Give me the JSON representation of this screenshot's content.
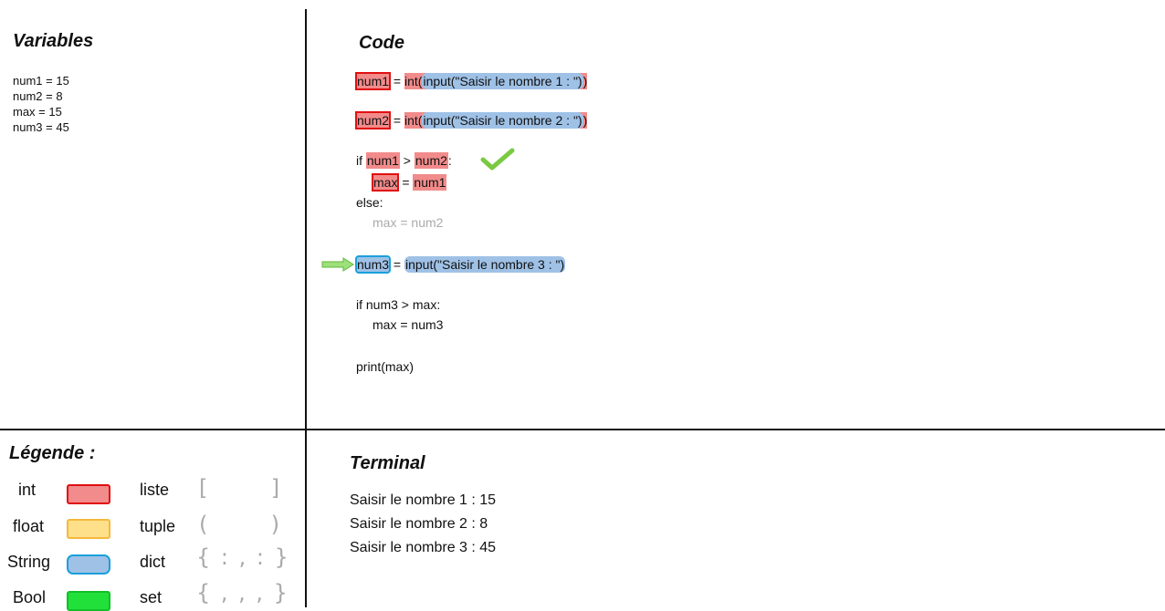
{
  "variables": {
    "heading": "Variables",
    "lines": [
      "num1 = 15",
      "num2 = 8",
      "max = 15",
      "num3 = 45"
    ]
  },
  "code": {
    "heading": "Code",
    "l1": {
      "var": "num1",
      "eq": " = ",
      "fn": "int(",
      "arg": "input(\"Saisir le nombre 1 : \")",
      "close": ")"
    },
    "l2": {
      "var": "num2",
      "eq": " = ",
      "fn": "int(",
      "arg": "input(\"Saisir le nombre 2 : \")",
      "close": ")"
    },
    "l3": {
      "kw": "if ",
      "a": "num1",
      "op": " > ",
      "b": "num2",
      "colon": ":"
    },
    "l4": {
      "var": "max",
      "eq": " = ",
      "val": "num1"
    },
    "l5": "else:",
    "l6": "max = num2",
    "l7": {
      "var": "num3",
      "eq": " = ",
      "arg": "input(\"Saisir le nombre 3 : \")"
    },
    "l8": "if num3 > max:",
    "l9": "max = num3",
    "l10": "print(max)"
  },
  "terminal": {
    "heading": "Terminal",
    "lines": [
      "Saisir le nombre 1 : 15",
      "Saisir le nombre 2 : 8",
      "Saisir le nombre 3 : 45"
    ]
  },
  "legend": {
    "heading": "Légende :",
    "types": [
      {
        "label": "int",
        "color": "#f28b8b",
        "border": "#e01010"
      },
      {
        "label": "float",
        "color": "#ffe08a",
        "border": "#f5b83d"
      },
      {
        "label": "String",
        "color": "#9fc1e6",
        "border": "#1aa0dc"
      },
      {
        "label": "Bool",
        "color": "#22e03a",
        "border": "#12c02a"
      }
    ],
    "containers": [
      {
        "label": "liste",
        "symbol": "[       ]"
      },
      {
        "label": "tuple",
        "symbol": "(       )"
      },
      {
        "label": "dict",
        "symbol": "{ : , : }"
      },
      {
        "label": "set",
        "symbol": "{ , , , }"
      }
    ]
  },
  "icons": {
    "check": "check-icon",
    "arrow": "arrow-right-icon"
  },
  "colors": {
    "int": "#f28b8b",
    "string": "#9fc1e6",
    "int_border": "#e01010",
    "string_border": "#1aa0dc",
    "check": "#7ac943",
    "arrow": "#7ac943"
  }
}
